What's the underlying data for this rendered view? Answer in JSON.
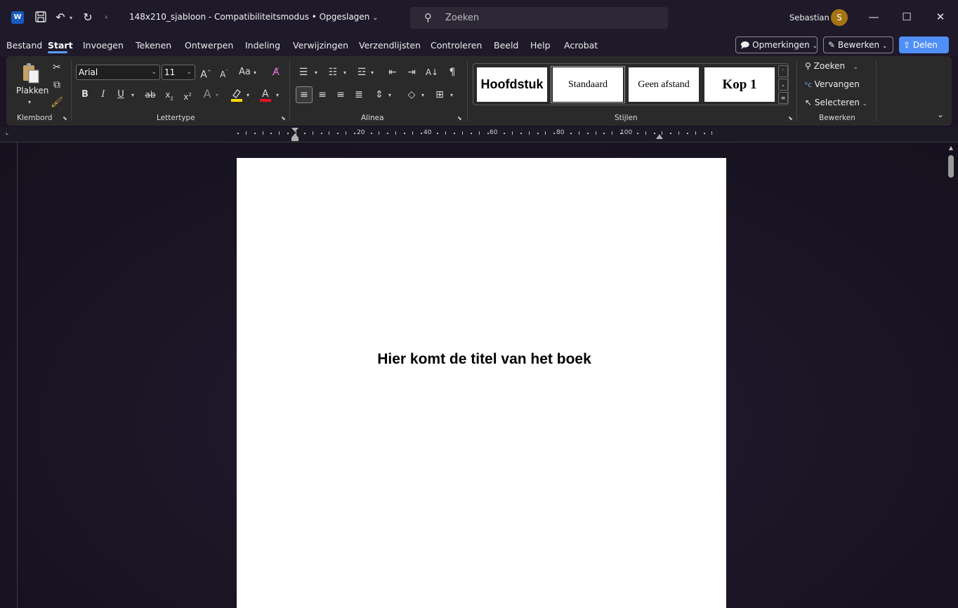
{
  "titlebar": {
    "doc_title": "148x210_sjabloon  -  Compatibiliteitsmodus • Opgeslagen",
    "search_placeholder": "Zoeken",
    "user_name": "Sebastian",
    "avatar_initial": "S"
  },
  "menu": {
    "tabs": [
      "Bestand",
      "Start",
      "Invoegen",
      "Tekenen",
      "Ontwerpen",
      "Indeling",
      "Verwijzingen",
      "Verzendlijsten",
      "Controleren",
      "Beeld",
      "Help",
      "Acrobat"
    ],
    "active_tab": "Start",
    "comments_label": "Opmerkingen",
    "edit_label": "Bewerken",
    "share_label": "Delen"
  },
  "ribbon": {
    "clipboard": {
      "paste_label": "Plakken",
      "group_label": "Klembord"
    },
    "font": {
      "font_name": "Arial",
      "font_size": "11",
      "case_label": "Aa",
      "group_label": "Lettertype"
    },
    "paragraph": {
      "group_label": "Alinea"
    },
    "styles": {
      "tiles": [
        "Hoofdstuk",
        "Standaard",
        "Geen afstand",
        "Kop 1"
      ],
      "group_label": "Stijlen"
    },
    "editing": {
      "find_label": "Zoeken",
      "replace_label": "Vervangen",
      "select_label": "Selecteren",
      "group_label": "Bewerken"
    }
  },
  "ruler": {
    "labels": [
      "20",
      "40",
      "60",
      "80",
      "100"
    ]
  },
  "document": {
    "title_text": "Hier komt de titel van het boek"
  },
  "colors": {
    "accent": "#4f8ff7",
    "avatar": "#a57512",
    "word_brand": "#185abd",
    "highlight_yellow": "#ffd800",
    "font_red": "#e81123"
  }
}
